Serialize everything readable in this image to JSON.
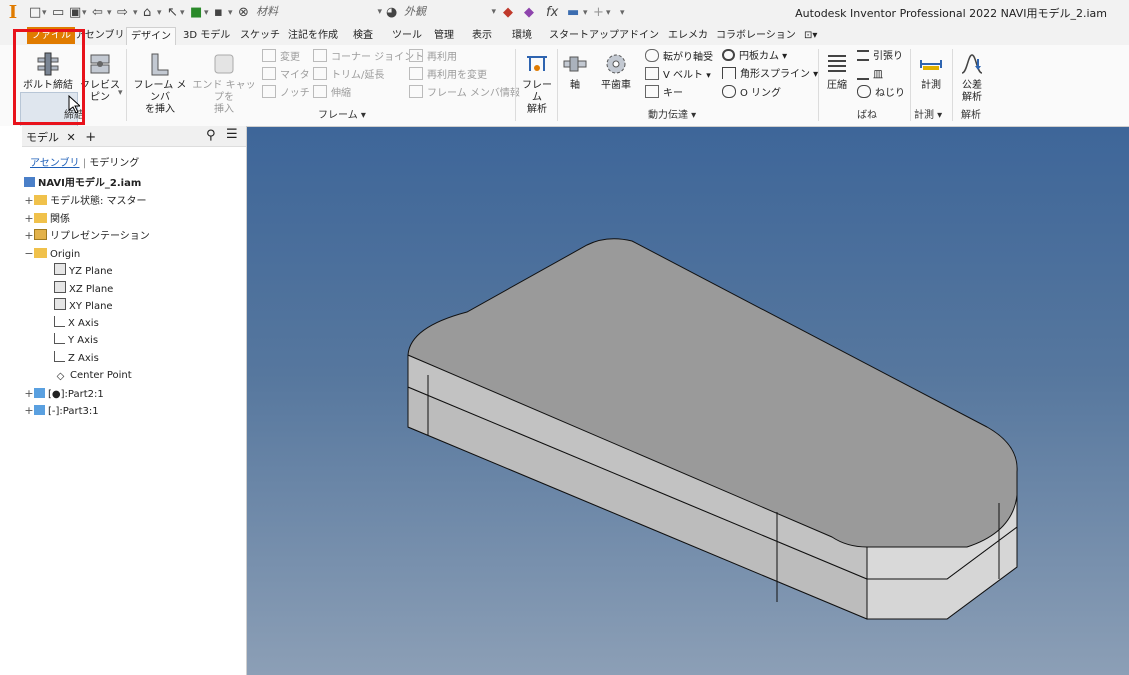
{
  "window": {
    "title": "Autodesk Inventor Professional 2022   NAVI用モデル_2.iam",
    "app_icon": "I"
  },
  "quick_access": {
    "material_field": "材料",
    "appearance_field": "外観",
    "fx_label": "fx"
  },
  "menu_tabs": [
    "ファイル",
    "アセンブリ",
    "デザイン",
    "3D モデル",
    "スケッチ",
    "注記を作成",
    "検査",
    "ツール",
    "管理",
    "表示",
    "環境",
    "スタートアップ",
    "アドイン",
    "エレメカ",
    "コラボレーション"
  ],
  "ribbon": {
    "fasten_group": {
      "bolt_label": "ボルト締結",
      "clevis_label_1": "クレビス",
      "clevis_label_2": "ピン",
      "group_label": "締結"
    },
    "frame_group": {
      "insert_label_1": "フレーム メンバ",
      "insert_label_2": "を挿入",
      "endcap_label_1": "エンド キャップを",
      "endcap_label_2": "挿入",
      "change": "変更",
      "corner_joint": "コーナー ジョイント",
      "reuse": "再利用",
      "miter": "マイタ",
      "trim_extend": "トリム/延長",
      "change_reuse": "再利用を変更",
      "notch": "ノッチ",
      "lengthen": "伸縮",
      "member_info": "フレーム メンバ情報",
      "group_label": "フレーム ▾"
    },
    "frame_analysis": {
      "label_1": "フレーム",
      "label_2": "解析"
    },
    "power_group": {
      "shaft": "軸",
      "spur_gear": "平歯車",
      "bearing": "転がり軸受",
      "vbelt": "V ベルト",
      "key": "キー",
      "disc_cam": "円板カム ▾",
      "spline": "角形スプライン ▾",
      "oring": "O リング",
      "group_label": "動力伝達 ▾"
    },
    "spring_group": {
      "compression": "圧縮",
      "extension": "引張り",
      "disc": "皿",
      "torsion": "ねじり",
      "group_label": "ばね"
    },
    "measure_group": {
      "measure": "計測",
      "group_label": "計測 ▾"
    },
    "analysis_group": {
      "tolerance_1": "公差",
      "tolerance_2": "解析",
      "group_label": "解析"
    }
  },
  "browser": {
    "tab_label": "モデル",
    "subtab_assembly": "アセンブリ",
    "subtab_modeling": "モデリング",
    "root": "NAVI用モデル_2.iam",
    "nodes": {
      "model_states": "モデル状態: マスター",
      "relations": "関係",
      "representations": "リプレゼンテーション",
      "origin": "Origin",
      "yz": "YZ Plane",
      "xz": "XZ Plane",
      "xy": "XY Plane",
      "xaxis": "X Axis",
      "yaxis": "Y Axis",
      "zaxis": "Z Axis",
      "center": "Center Point",
      "part2": "[●]:Part2:1",
      "part3": "[-]:Part3:1"
    }
  },
  "colors": {
    "accent": "#e07b00",
    "highlight": "#e8121b",
    "viewport_top": "#3e6699",
    "viewport_bottom": "#8c9fb6"
  }
}
